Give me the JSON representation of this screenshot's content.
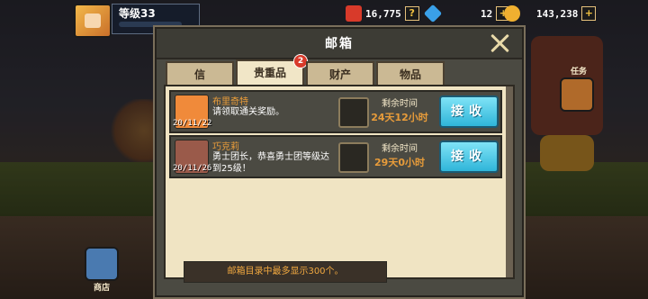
{
  "hud": {
    "level": "等级33",
    "resources": [
      {
        "icon": "red-star-icon",
        "value": "16,775",
        "color": "#d83a2a"
      },
      {
        "icon": "blue-gem-icon",
        "value": "12",
        "color": "#3aa0e8"
      },
      {
        "icon": "gold-coin-icon",
        "value": "143,238",
        "color": "#f0b030"
      }
    ]
  },
  "side": {
    "labels": [
      "商店",
      "任务"
    ]
  },
  "dialog": {
    "title": "邮箱",
    "tabs": [
      {
        "label": "信",
        "active": false
      },
      {
        "label": "贵重品",
        "active": true,
        "badge": "2"
      },
      {
        "label": "财产",
        "active": false
      },
      {
        "label": "物品",
        "active": false
      }
    ],
    "mails": [
      {
        "sender": "布里奇特",
        "body": "请领取通关奖励。",
        "date": "20/11/22",
        "time_label": "剩余时间",
        "time_value": "24天12小时",
        "button": "接收",
        "avatar_color": "#f08a3a"
      },
      {
        "sender": "巧克莉",
        "body": "勇士团长，恭喜勇士团等级达到25级！",
        "date": "20/11/26",
        "time_label": "剩余时间",
        "time_value": "29天0小时",
        "button": "接收",
        "avatar_color": "#9a5a4a"
      }
    ],
    "footer": "邮箱目录中最多显示300个。"
  },
  "colors": {
    "panel": "#f0e4c3",
    "accent_orange": "#e89c3a",
    "button_blue": "#2fb5d9"
  }
}
